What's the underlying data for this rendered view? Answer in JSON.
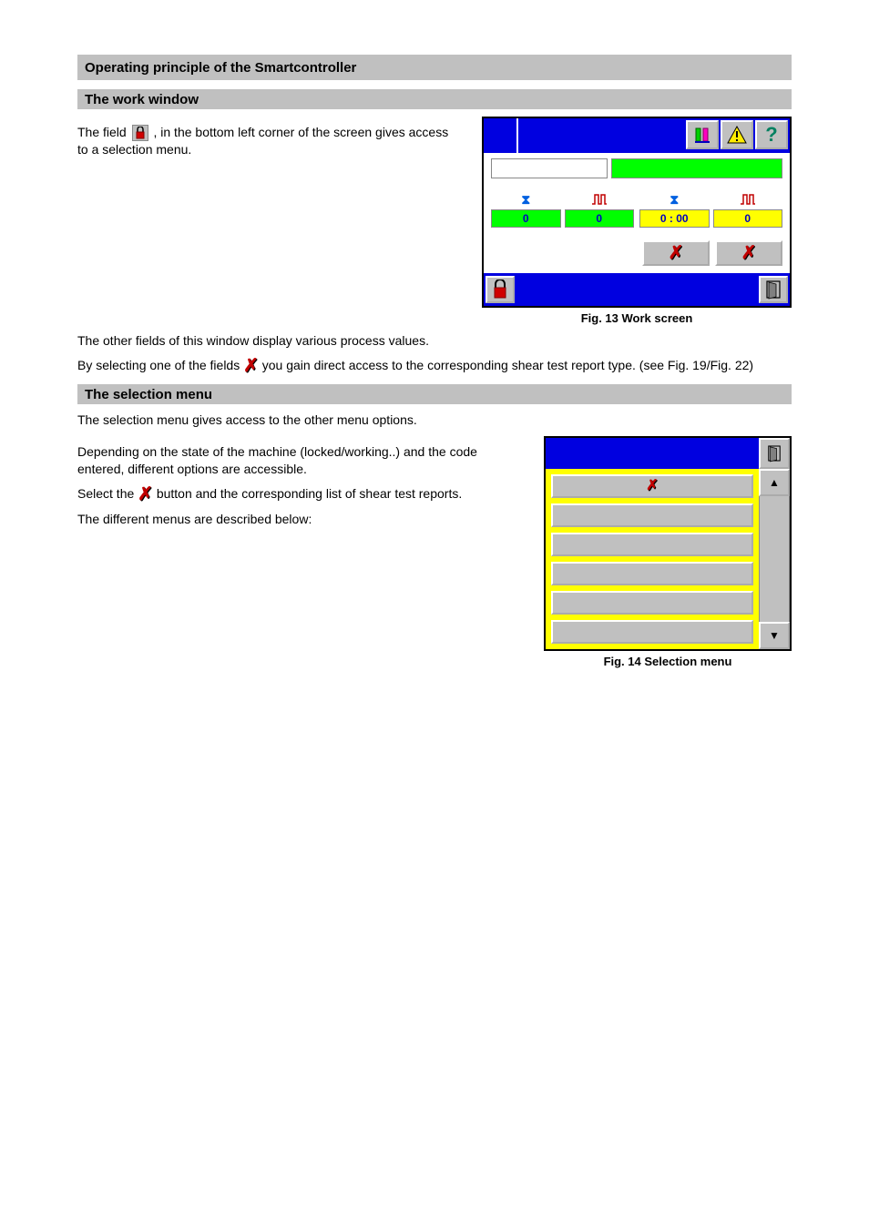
{
  "header": {
    "title": "Operating principle of the Smartcontroller"
  },
  "section1": {
    "title": "The work window",
    "p1_pre": "The field ",
    "p1_post": ", in the bottom left corner of the screen gives access to a selection menu."
  },
  "panel1": {
    "vals": {
      "g1": "0",
      "g2": "0",
      "y1": "0 : 00",
      "y2": "0"
    },
    "caption": "Fig. 13 Work screen"
  },
  "section1b": {
    "p2_pre": "The other fields of this window display various process values.",
    "p3_pre": "By selecting one of the fields ",
    "p3_post": " you gain direct access to the corresponding shear test report type.",
    "figref": "(see Fig. 19/Fig. 22)"
  },
  "section2": {
    "title": "The selection menu",
    "p1": "The selection menu gives access to the other menu options.",
    "p2": "Depending on the state of the machine (locked/working..) and the code entered, different options are accessible.",
    "p3_pre": "Select the ",
    "p3_post": " button and the corresponding list of shear test reports.",
    "p4": "The different menus are described below:"
  },
  "panel2": {
    "caption": "Fig. 14 Selection menu"
  }
}
